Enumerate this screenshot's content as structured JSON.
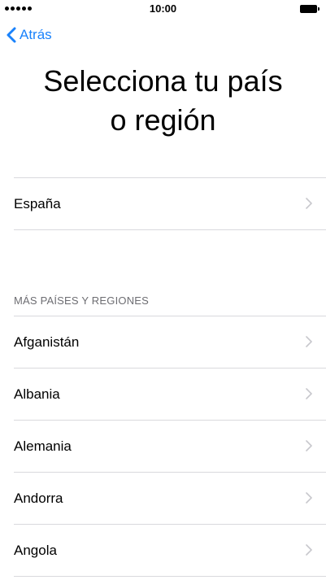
{
  "status_bar": {
    "time": "10:00"
  },
  "nav": {
    "back_label": "Atrás"
  },
  "title": {
    "line1": "Selecciona tu país",
    "line2": "o región"
  },
  "suggested": {
    "items": [
      {
        "label": "España"
      }
    ]
  },
  "more": {
    "header": "MÁS PAÍSES Y REGIONES",
    "items": [
      {
        "label": "Afganistán"
      },
      {
        "label": "Albania"
      },
      {
        "label": "Alemania"
      },
      {
        "label": "Andorra"
      },
      {
        "label": "Angola"
      }
    ]
  },
  "colors": {
    "accent": "#1a82fb",
    "separator": "#d9d9dd",
    "chevron": "#c7c7cc",
    "section_header": "#6d6d72"
  },
  "icons": {
    "back": "chevron-left-icon",
    "row": "chevron-right-icon",
    "battery": "battery-icon",
    "signal": "signal-dots-icon"
  }
}
